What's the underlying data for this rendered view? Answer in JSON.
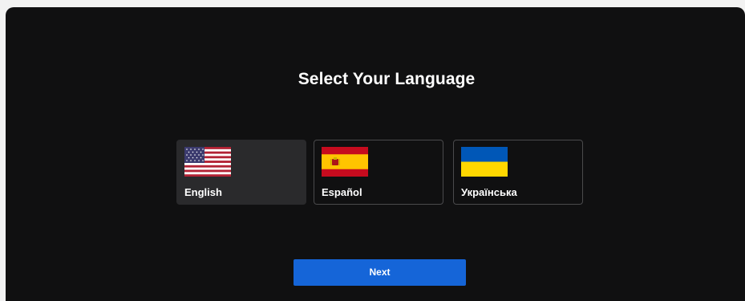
{
  "screen": {
    "title": "Select Your Language"
  },
  "languages": [
    {
      "label": "English",
      "flag": "us-flag-icon",
      "selected": true
    },
    {
      "label": "Español",
      "flag": "spain-flag-icon",
      "selected": false
    },
    {
      "label": "Українська",
      "flag": "ukraine-flag-icon",
      "selected": false
    }
  ],
  "actions": {
    "next_label": "Next"
  },
  "colors": {
    "background": "#101011",
    "selected_card": "#2a2a2c",
    "card_border": "#4a4a4c",
    "accent": "#1565d8"
  }
}
